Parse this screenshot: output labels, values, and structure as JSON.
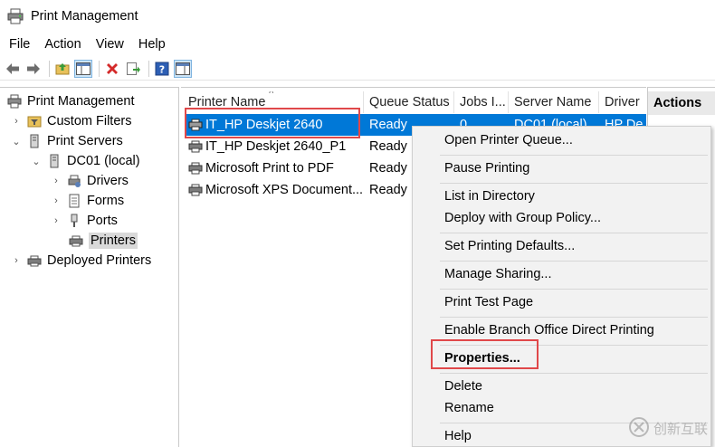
{
  "window": {
    "title": "Print Management"
  },
  "menubar": {
    "items": [
      "File",
      "Action",
      "View",
      "Help"
    ]
  },
  "toolbar": {
    "buttons": [
      "back-arrow-icon",
      "forward-arrow-icon",
      "up-folder-icon",
      "show-hide-tree-icon",
      "delete-icon",
      "export-list-icon",
      "help-icon",
      "show-hide-action-pane-icon"
    ]
  },
  "tree": {
    "items": [
      {
        "label": "Print Management",
        "icon": "print-management-icon"
      },
      {
        "label": "Custom Filters",
        "icon": "filter-folder-icon"
      },
      {
        "label": "Print Servers",
        "icon": "server-icon"
      },
      {
        "label": "DC01 (local)",
        "icon": "server-icon"
      },
      {
        "label": "Drivers",
        "icon": "drivers-icon"
      },
      {
        "label": "Forms",
        "icon": "forms-icon"
      },
      {
        "label": "Ports",
        "icon": "ports-icon"
      },
      {
        "label": "Printers",
        "icon": "printer-icon"
      },
      {
        "label": "Deployed Printers",
        "icon": "printer-icon"
      }
    ]
  },
  "list": {
    "columns": [
      "Printer Name",
      "Queue Status",
      "Jobs I...",
      "Server Name",
      "Driver"
    ],
    "rows": [
      {
        "name": "IT_HP Deskjet 2640",
        "status": "Ready",
        "jobs": "0",
        "server": "DC01 (local)",
        "driver": "HP De"
      },
      {
        "name": "IT_HP Deskjet 2640_P1",
        "status": "Ready",
        "jobs": "",
        "server": "",
        "driver": ""
      },
      {
        "name": "Microsoft Print to PDF",
        "status": "Ready",
        "jobs": "",
        "server": "",
        "driver": ""
      },
      {
        "name": "Microsoft XPS Document...",
        "status": "Ready",
        "jobs": "",
        "server": "",
        "driver": ""
      }
    ]
  },
  "actions": {
    "title": "Actions"
  },
  "context_menu": {
    "items": [
      "Open Printer Queue...",
      "Pause Printing",
      "List in Directory",
      "Deploy with Group Policy...",
      "Set Printing Defaults...",
      "Manage Sharing...",
      "Print Test Page",
      "Enable Branch Office Direct Printing",
      "Properties...",
      "Delete",
      "Rename",
      "Help"
    ]
  },
  "watermark": {
    "text": "创新互联"
  },
  "colors": {
    "selection": "#0078d7",
    "highlight_box": "#e0484a",
    "menu_bg": "#f2f2f2"
  }
}
